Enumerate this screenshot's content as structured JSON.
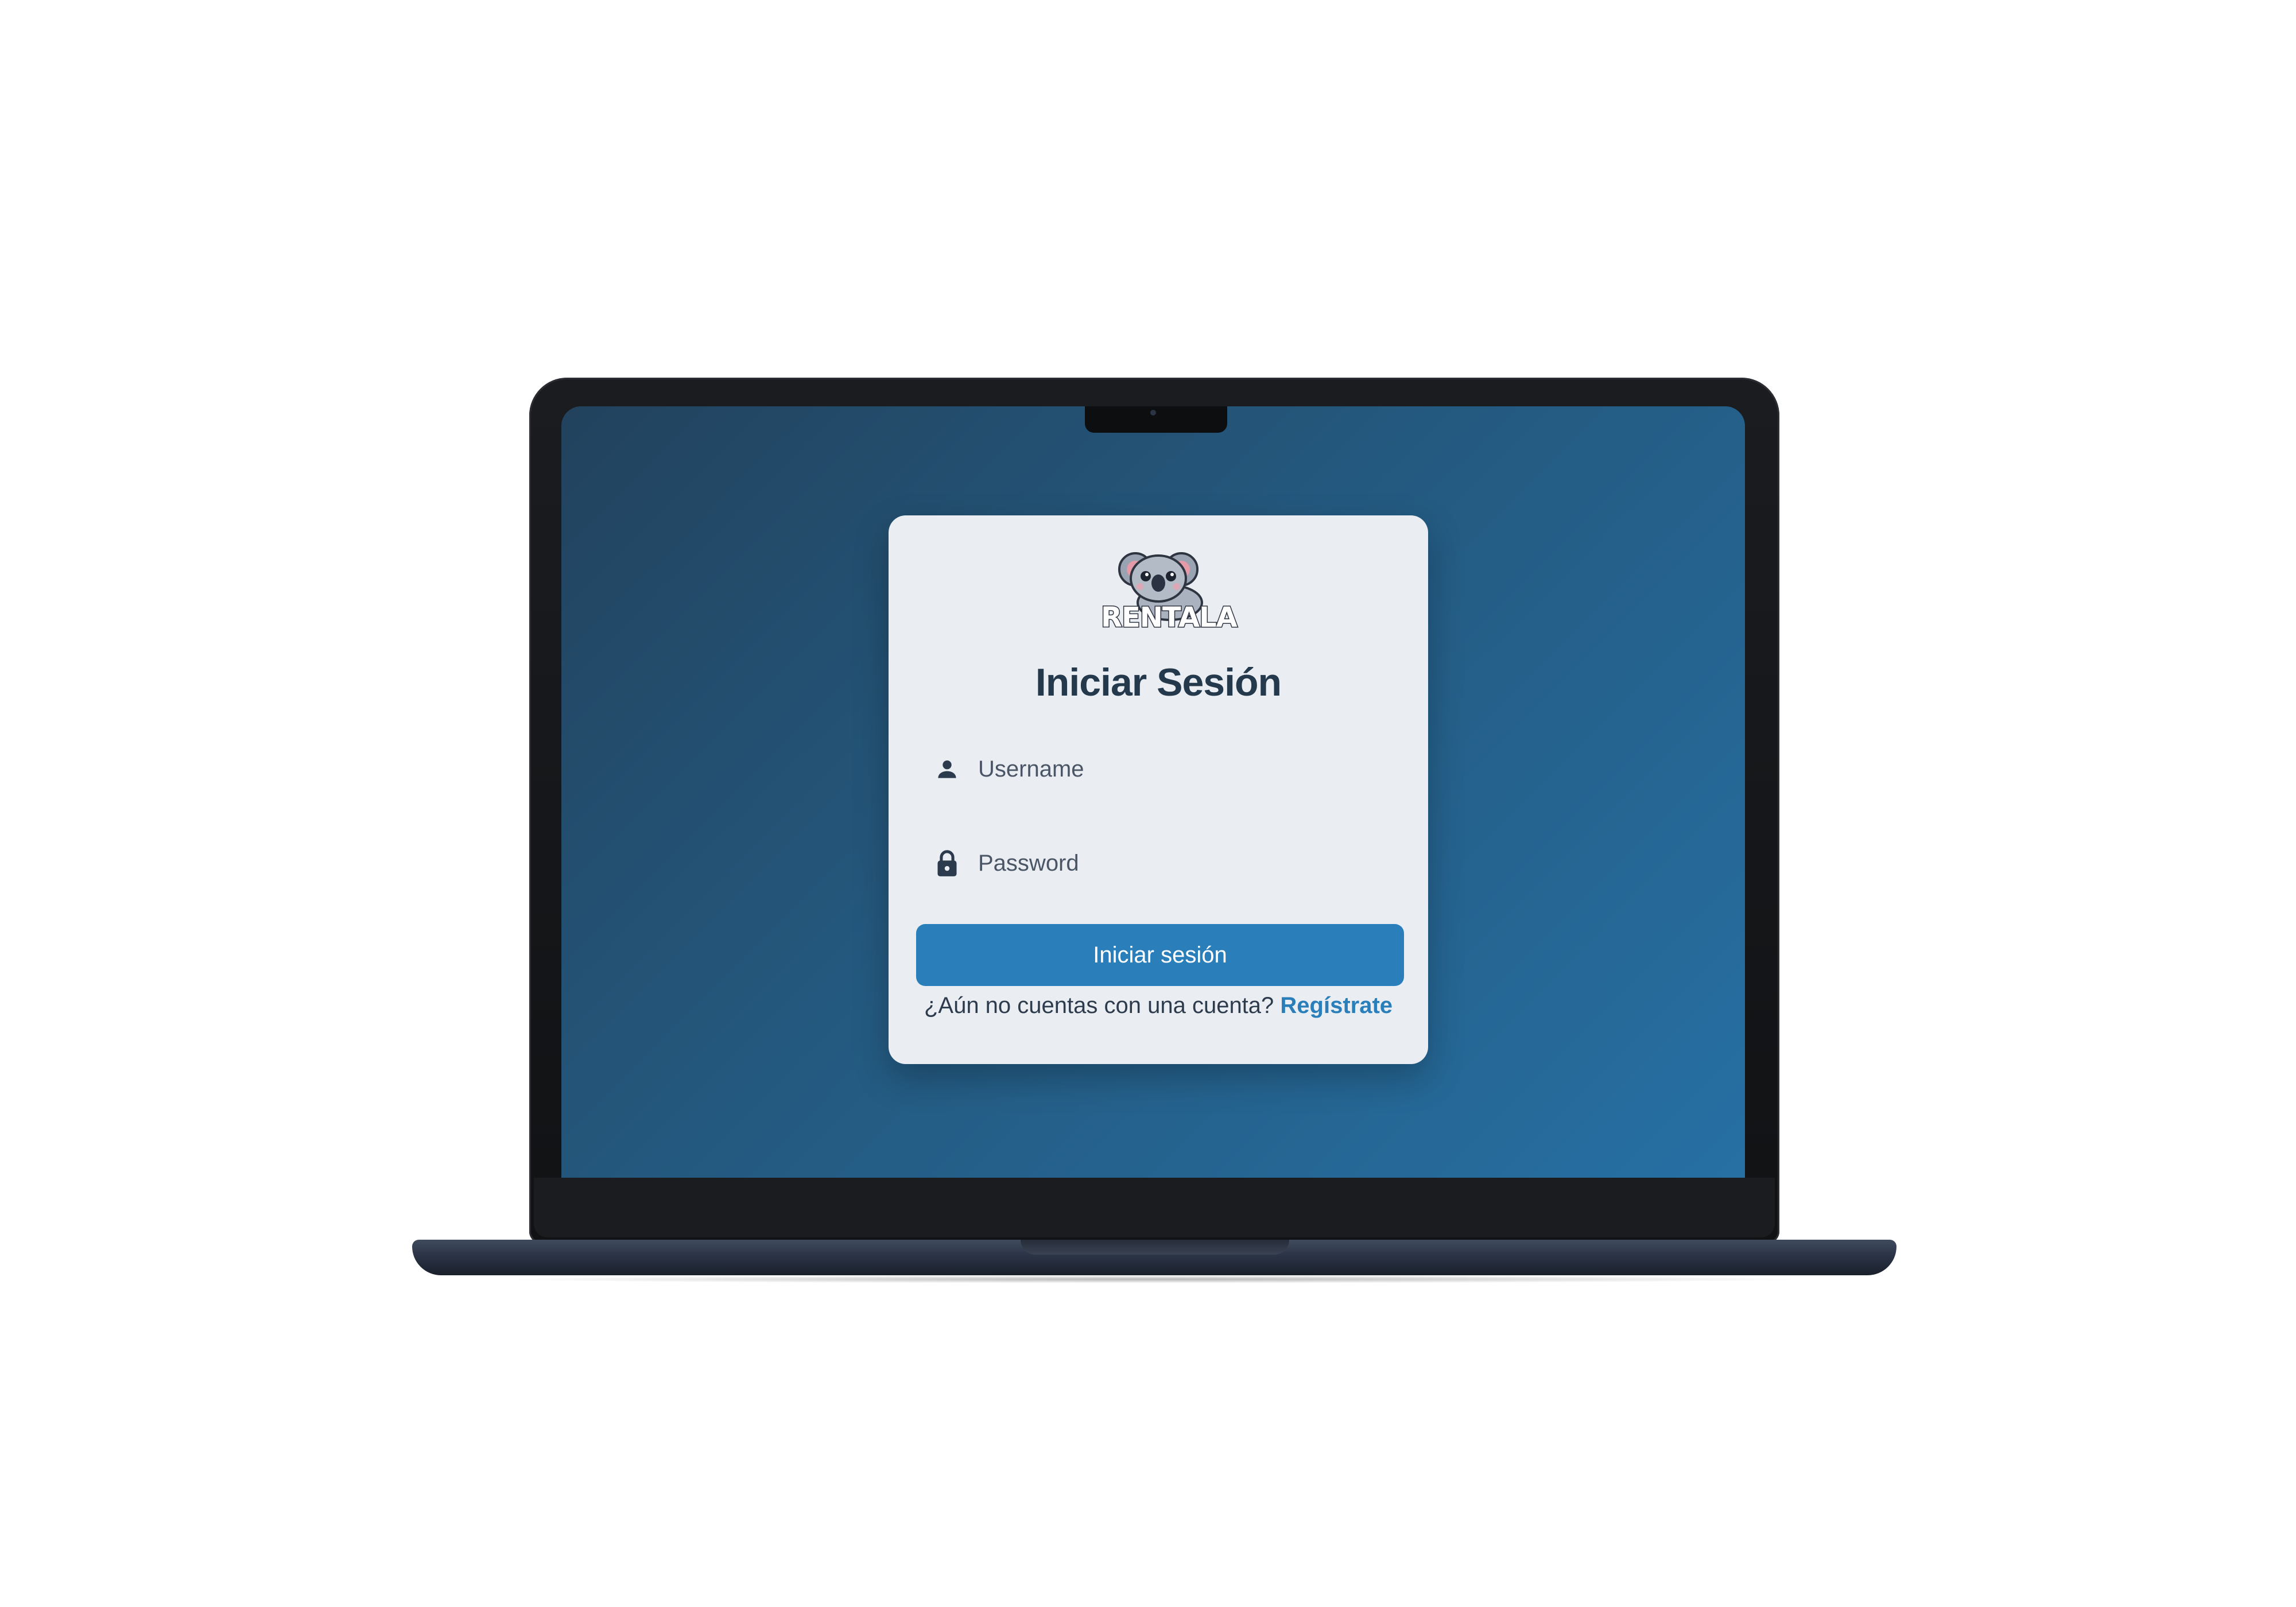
{
  "app": {
    "logo_text": "RENTALA"
  },
  "login": {
    "title": "Iniciar Sesión",
    "username_placeholder": "Username",
    "password_placeholder": "Password",
    "submit_label": "Iniciar sesión",
    "signup_prompt": "¿Aún no cuentas con una cuenta?",
    "signup_link": "Regístrate"
  },
  "icons": {
    "user": "person-icon",
    "password": "lock-icon",
    "logo": "koala-logo"
  },
  "colors": {
    "screen_background_start": "#22425d",
    "screen_background_end": "#2670a4",
    "card_background": "#eaeef2",
    "title_text": "#25394d",
    "primary_button": "#2a7fbb",
    "link": "#2a7fbb"
  }
}
